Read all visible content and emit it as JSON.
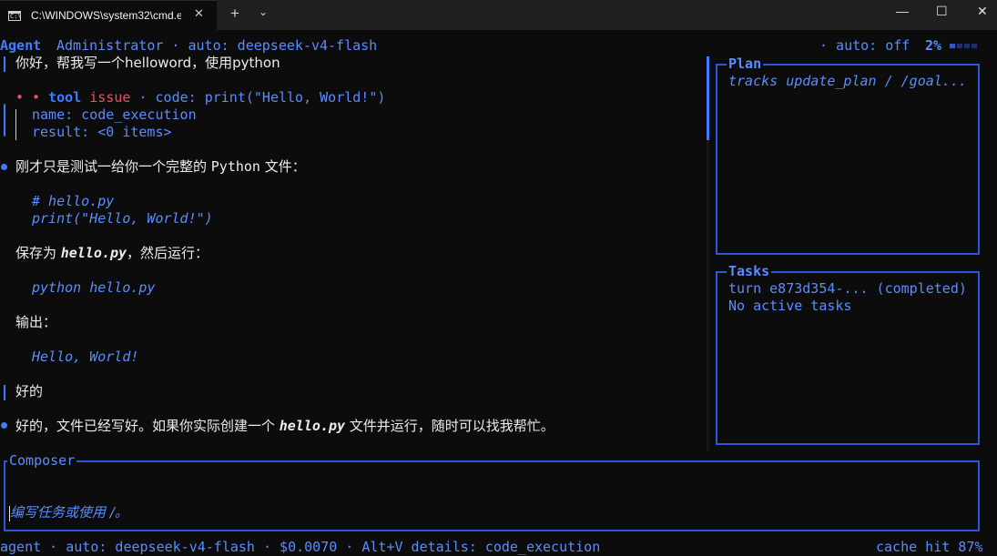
{
  "window": {
    "tab_title": "C:\\WINDOWS\\system32\\cmd.e",
    "tab_close": "✕",
    "new_tab": "+",
    "dropdown": "⌄",
    "minimize": "—",
    "maximize": "☐",
    "close": "✕",
    "cmd_icon_text": "C:\\"
  },
  "header": {
    "agent": "Agent",
    "user_model": "Administrator · auto: deepseek-v4-flash",
    "auto_status": "· auto: off",
    "percent": "2%",
    "progress_fraction": 0.02
  },
  "chat": {
    "user_message_1": "你好，帮我写一个helloword，使用python",
    "tool": {
      "dots": "• •",
      "label": "tool",
      "status": "issue",
      "code_text": "· code: print(\"Hello, World!\")",
      "name_line": "name: code_execution",
      "result_line": "result: <0 items>"
    },
    "assistant_1": {
      "intro_prefix": "刚才只是测试一给你一个完整的 ",
      "intro_python": "Python",
      "intro_suffix": " 文件：",
      "code_line_1": "# hello.py",
      "code_line_2": "print(\"Hello, World!\")",
      "save_prefix": "保存为 ",
      "save_file": "hello.py",
      "save_suffix": "，然后运行：",
      "run_cmd": "python hello.py",
      "output_label": "输出：",
      "output_value": "Hello, World!"
    },
    "user_message_2": "好的",
    "assistant_2": {
      "prefix": "好的，文件已经写好。如果你实际创建一个 ",
      "file": "hello.py",
      "suffix": " 文件并运行，随时可以找我帮忙。"
    }
  },
  "plan_panel": {
    "title": "Plan",
    "content": "tracks update_plan / /goal..."
  },
  "tasks_panel": {
    "title": "Tasks",
    "line_1": "turn e873d354-... (completed)",
    "line_2": "No active tasks"
  },
  "composer": {
    "title": "Composer",
    "placeholder": "编写任务或使用 /。"
  },
  "status_bar": {
    "left": "agent · auto: deepseek-v4-flash · $0.0070 · Alt+V details: code_execution",
    "right": "cache hit 87%"
  },
  "colors": {
    "accent": "#3f7bff",
    "panel_border": "#2d56d9",
    "error": "#f25060",
    "background": "#0c0c0c"
  }
}
